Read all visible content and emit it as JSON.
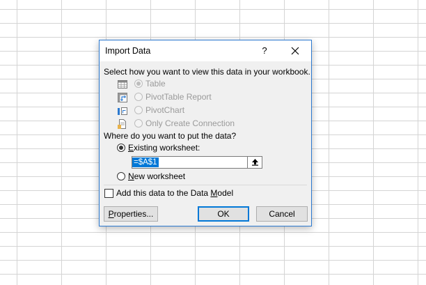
{
  "dialog": {
    "title": "Import Data",
    "help_label": "?",
    "prompt_view": "Select how you want to view this data in your workbook.",
    "view_options": [
      {
        "label": "Table",
        "icon": "table-icon",
        "selected": true,
        "enabled": false
      },
      {
        "label": "PivotTable Report",
        "icon": "pivottable-icon",
        "selected": false,
        "enabled": false
      },
      {
        "label": "PivotChart",
        "icon": "pivotchart-icon",
        "selected": false,
        "enabled": false
      },
      {
        "label": "Only Create Connection",
        "icon": "connection-icon",
        "selected": false,
        "enabled": false
      }
    ],
    "prompt_location": "Where do you want to put the data?",
    "existing_worksheet": {
      "accel": "E",
      "rest": "xisting worksheet:",
      "selected": true
    },
    "range_value": "=$A$1",
    "new_worksheet": {
      "accel": "N",
      "rest": "ew worksheet",
      "selected": false
    },
    "data_model": {
      "before": "Add this data to the Data ",
      "accel": "M",
      "after": "odel",
      "checked": false
    },
    "buttons": {
      "properties": {
        "accel": "P",
        "rest": "roperties..."
      },
      "ok": "OK",
      "cancel": "Cancel"
    }
  },
  "colors": {
    "accent": "#0078d7",
    "dialog_border": "#2b79d0",
    "dialog_bg": "#f0f0f0"
  }
}
